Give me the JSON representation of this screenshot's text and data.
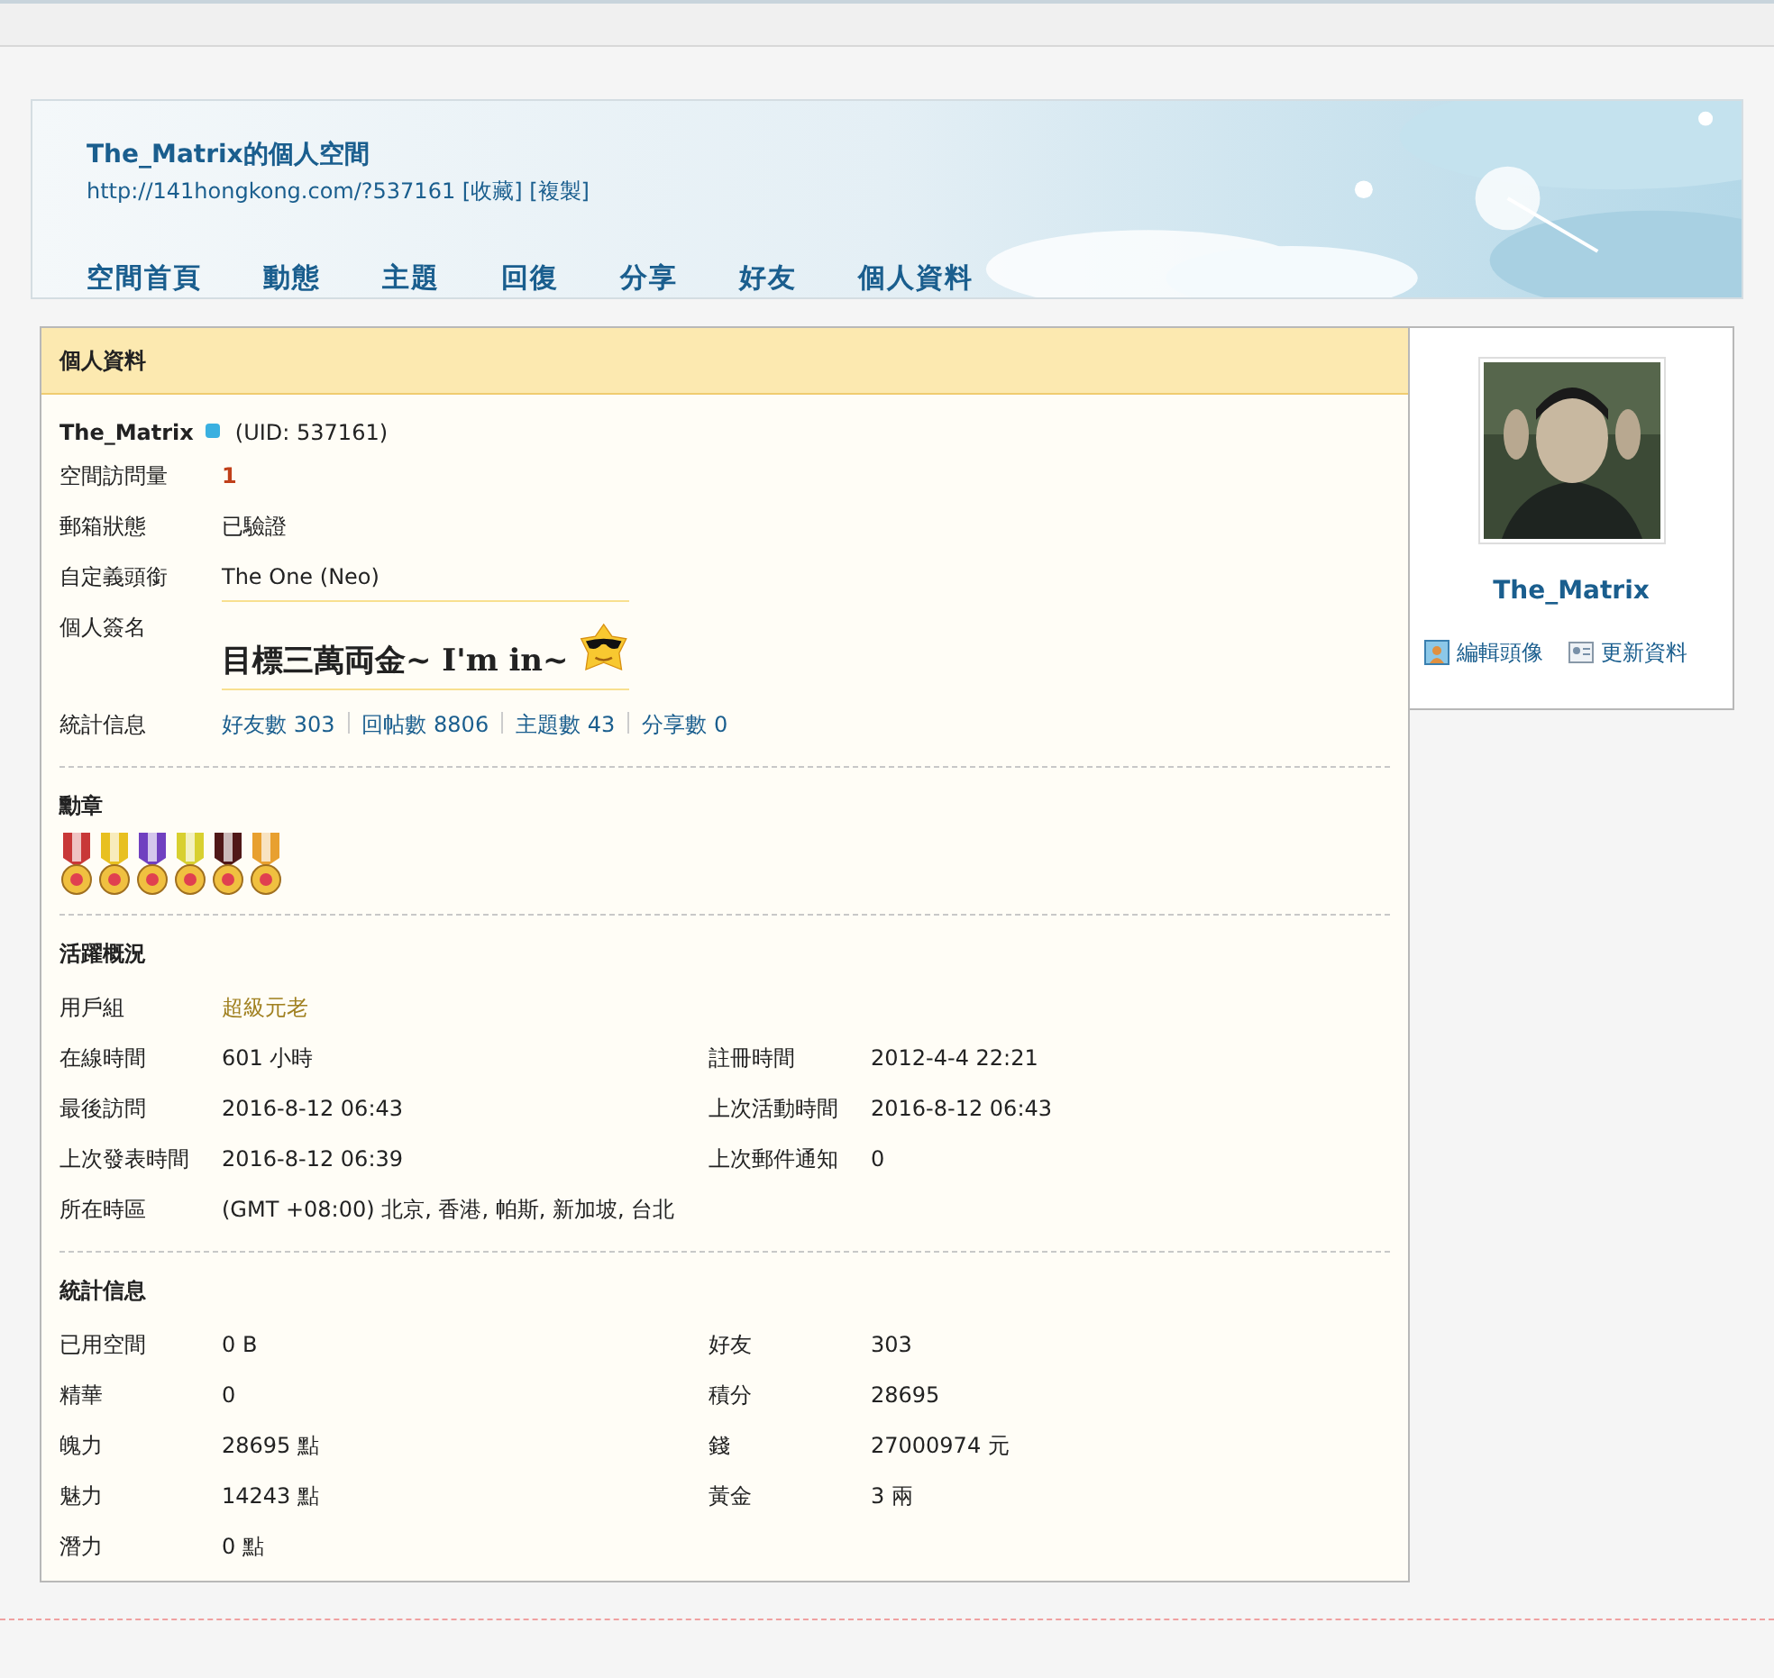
{
  "header": {
    "title": "The_Matrix的個人空間",
    "url": "http://141hongkong.com/?537161",
    "links": [
      "[收藏]",
      "[複製]"
    ],
    "nav": [
      "空間首頁",
      "動態",
      "主題",
      "回復",
      "分享",
      "好友",
      "個人資料"
    ]
  },
  "profile": {
    "title": "個人資料",
    "username": "The_Matrix",
    "uid": "(UID: 537161)",
    "fields": [
      {
        "kind": "count",
        "label": "空間訪問量",
        "value": "1"
      },
      {
        "kind": "text",
        "label": "郵箱狀態",
        "value": "已驗證"
      },
      {
        "kind": "text",
        "label": "自定義頭銜",
        "value": "The One (Neo)"
      },
      {
        "kind": "signature",
        "label": "個人簽名",
        "value": "目標三萬両金~ I'm in~"
      },
      {
        "kind": "stats",
        "label": "統計信息",
        "links": [
          "好友數 303",
          "回帖數 8806",
          "主題數 43",
          "分享數 0"
        ]
      }
    ],
    "medals": {
      "title": "勳章",
      "items": [
        {
          "color": "#c83838"
        },
        {
          "color": "#e8c020"
        },
        {
          "color": "#7040c0"
        },
        {
          "color": "#d8d030"
        },
        {
          "color": "#501818"
        },
        {
          "color": "#e8a030"
        }
      ]
    },
    "activity": {
      "title": "活躍概況",
      "rows": [
        [
          {
            "kind": "group",
            "label": "用戶組",
            "value": "超級元老"
          }
        ],
        [
          {
            "kind": "plain",
            "label": "在線時間",
            "value": "601 小時"
          },
          {
            "kind": "plain",
            "label": "註冊時間",
            "value": "2012-4-4 22:21"
          }
        ],
        [
          {
            "kind": "plain",
            "label": "最後訪問",
            "value": "2016-8-12 06:43"
          },
          {
            "kind": "plain",
            "label": "上次活動時間",
            "value": "2016-8-12 06:43"
          }
        ],
        [
          {
            "kind": "plain",
            "label": "上次發表時間",
            "value": "2016-8-12 06:39"
          },
          {
            "kind": "plain",
            "label": "上次郵件通知",
            "value": "0"
          }
        ],
        [
          {
            "kind": "plain",
            "label": "所在時區",
            "value": "(GMT +08:00) 北京, 香港, 帕斯, 新加坡, 台北"
          }
        ]
      ]
    },
    "statistics": {
      "title": "統計信息",
      "rows": [
        [
          {
            "kind": "plain",
            "label": "已用空間",
            "value": "0 B"
          },
          {
            "kind": "plain",
            "label": "好友",
            "value": "303"
          }
        ],
        [
          {
            "kind": "plain",
            "label": "精華",
            "value": "0"
          },
          {
            "kind": "plain",
            "label": "積分",
            "value": "28695"
          }
        ],
        [
          {
            "kind": "plain",
            "label": "魄力",
            "value": "28695 點"
          },
          {
            "kind": "plain",
            "label": "錢",
            "value": "27000974 元"
          }
        ],
        [
          {
            "kind": "plain",
            "label": "魅力",
            "value": "14243 點"
          },
          {
            "kind": "plain",
            "label": "黃金",
            "value": "3 兩"
          }
        ],
        [
          {
            "kind": "plain",
            "label": "潛力",
            "value": "0 點"
          }
        ]
      ]
    }
  },
  "sidebar": {
    "username": "The_Matrix",
    "actions": [
      {
        "kind": "avatar",
        "label": "編輯頭像"
      },
      {
        "kind": "card",
        "label": "更新資料"
      }
    ]
  }
}
